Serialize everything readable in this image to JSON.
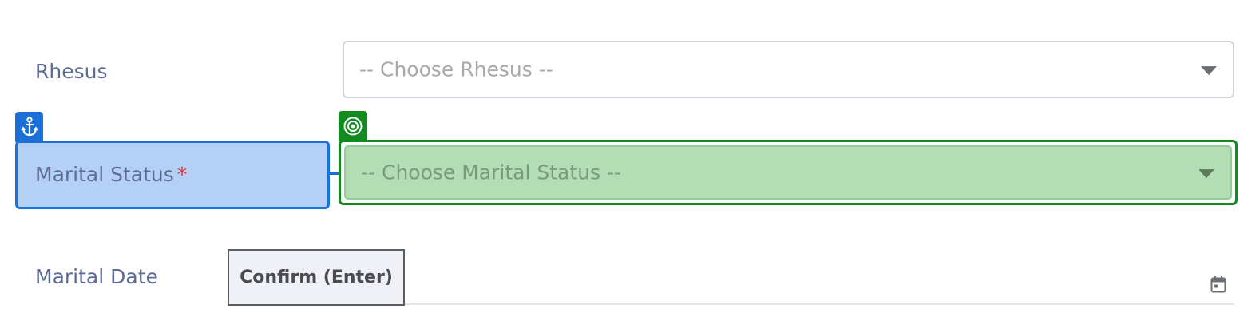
{
  "form": {
    "rhesus": {
      "label": "Rhesus",
      "placeholder": "-- Choose Rhesus --"
    },
    "marital_status": {
      "label": "Marital Status",
      "required_marker": "*",
      "placeholder": "-- Choose Marital Status --"
    },
    "marital_date": {
      "label": "Marital Date"
    }
  },
  "tooltip": {
    "text": "Confirm (Enter)"
  },
  "icons": {
    "anchor_tab": "anchor-icon",
    "target_tab": "target-icon",
    "calendar": "calendar-icon",
    "select_caret": "chevron-down-icon"
  },
  "colors": {
    "label": "#5c6b94",
    "anchor_highlight": "#1a70d8",
    "anchor_fill": "#b4d1f5",
    "target_highlight": "#118a1e",
    "target_fill": "#b3ddb5",
    "required": "#d93a3a"
  }
}
